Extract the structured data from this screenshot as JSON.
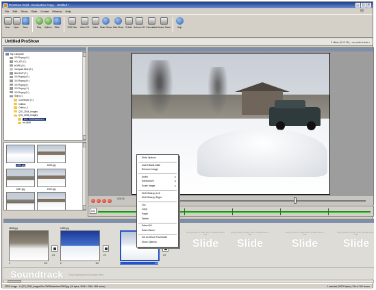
{
  "window": {
    "title": "ProShow Gold - Evaluation Copy - Untitled *",
    "controls": [
      "_",
      "□",
      "×"
    ]
  },
  "menu": [
    "File",
    "Edit",
    "Show",
    "Slide",
    "Create",
    "Window",
    "Help"
  ],
  "toolbar": [
    {
      "label": "New",
      "icon": "new-icon"
    },
    {
      "label": "Open",
      "icon": "open-icon"
    },
    {
      "label": "Save",
      "icon": "save-icon"
    },
    {
      "label": "Play",
      "icon": "play-icon"
    },
    {
      "label": "Options",
      "icon": "options-icon"
    },
    {
      "label": "Slide",
      "icon": "slide-icon"
    },
    {
      "label": "DVD Disc",
      "icon": "dvd-icon"
    },
    {
      "label": "Video CD",
      "icon": "video-cd-icon"
    },
    {
      "label": "Video",
      "icon": "video-icon"
    },
    {
      "label": "Share Show",
      "icon": "share-icon"
    },
    {
      "label": "Web Show",
      "icon": "web-icon"
    },
    {
      "label": "E-Mail",
      "icon": "email-icon"
    },
    {
      "label": "Autorun CD",
      "icon": "autorun-icon"
    },
    {
      "label": "Executable",
      "icon": "executable-icon"
    },
    {
      "label": "Screen Saver",
      "icon": "screensaver-icon"
    },
    {
      "label": "Help",
      "icon": "help-icon"
    }
  ],
  "document": {
    "name": "Untitled ProShow",
    "info": "3 slides (0:12.00), • no audio tracks •"
  },
  "tree": [
    {
      "label": "My Computer",
      "icon": "pc",
      "indent": 0
    },
    {
      "label": "3.5 Floppy (A:)",
      "icon": "drive",
      "indent": 1
    },
    {
      "label": "HD_XP (C:)",
      "icon": "drive",
      "indent": 1
    },
    {
      "label": "HOPE (D:)",
      "icon": "drive",
      "indent": 1
    },
    {
      "label": "Compact Disc (E:)",
      "icon": "cd",
      "indent": 1
    },
    {
      "label": "BACKUP (F:)",
      "icon": "drive",
      "indent": 1
    },
    {
      "label": "3.5 Floppy (G:)",
      "icon": "drive",
      "indent": 1
    },
    {
      "label": "3.5 Floppy (H:)",
      "icon": "drive",
      "indent": 1
    },
    {
      "label": "3.5 Floppy (I:)",
      "icon": "drive",
      "indent": 1
    },
    {
      "label": "3.5 Floppy (J:)",
      "icon": "drive",
      "indent": 1
    },
    {
      "label": "3.5 Floppy (K:)",
      "icon": "drive",
      "indent": 1
    },
    {
      "label": "Skip (L:)",
      "icon": "drive",
      "indent": 1
    },
    {
      "label": "CoreShare (Y:)",
      "icon": "folder",
      "indent": 2
    },
    {
      "label": "Outbox",
      "icon": "folder",
      "indent": 2
    },
    {
      "label": "Outbox_1",
      "icon": "folder",
      "indent": 2
    },
    {
      "label": "Q70_2004_Images",
      "icon": "folder",
      "indent": 2
    },
    {
      "label": "Q70_2005_Images",
      "icon": "folder",
      "indent": 2
    },
    {
      "label": "Dec 2005Wasteland",
      "icon": "folder",
      "indent": 3,
      "selected": true
    },
    {
      "label": "tm-0405",
      "icon": "folder",
      "indent": 3
    }
  ],
  "thumbs": [
    {
      "caption": "1893.jpg",
      "style": "snowpic",
      "selected": true
    },
    {
      "caption": "1893.jpg",
      "style": "housepic"
    },
    {
      "caption": "1897.jpg",
      "style": "housepic2"
    },
    {
      "caption": "1902.jpg",
      "style": "housepic"
    },
    {
      "caption": "",
      "style": "housepic2"
    },
    {
      "caption": "",
      "style": "housepic"
    }
  ],
  "player": {
    "time": "0:00.00",
    "timeline_box": "0:00"
  },
  "context_menu": [
    {
      "label": "Slide Options"
    },
    {
      "sep": true
    },
    {
      "label": "Insert Blank Slide"
    },
    {
      "label": "Remove Image"
    },
    {
      "sep": true
    },
    {
      "label": "Audio",
      "sub": true
    },
    {
      "label": "Randomize",
      "sub": true
    },
    {
      "label": "Scale Image",
      "sub": true
    },
    {
      "sep": true
    },
    {
      "label": "Shift Slide(s) Left"
    },
    {
      "label": "Shift Slide(s) Right"
    },
    {
      "sep": true
    },
    {
      "label": "Cut"
    },
    {
      "label": "Copy"
    },
    {
      "label": "Paste"
    },
    {
      "label": "Delete"
    },
    {
      "sep": true
    },
    {
      "label": "Select All"
    },
    {
      "label": "Select None"
    },
    {
      "sep": true
    },
    {
      "label": "Set as Show Thumbnail"
    },
    {
      "label": "Show Options"
    }
  ],
  "slides": [
    {
      "name": "1893.jpg",
      "num": "1",
      "dur": "3.0",
      "style": "darkpic",
      "trans": "2.0"
    },
    {
      "name": "1899.jpg",
      "num": "2",
      "dur": "3.0",
      "style": "bluepic",
      "trans": "2.0"
    },
    {
      "name": "",
      "num": "3",
      "dur": "3.0",
      "style": "snowpic",
      "trans": "2.0",
      "selected": true
    }
  ],
  "empty_slot": {
    "hint": "Drop photos or video here. Double click to edit.",
    "big": "Slide"
  },
  "soundtrack": {
    "big": "Soundtrack",
    "hint": "Drop background songs here"
  },
  "status": {
    "left": "JPEG Image - L:\\Q70_2005_Images\\Dec 2005Wasteland\\1893.jpg (1K bytes, 3648 × 2048, 16M colors)",
    "right": "1 selected (29276 bytes), 24b of 1K2 shown"
  }
}
